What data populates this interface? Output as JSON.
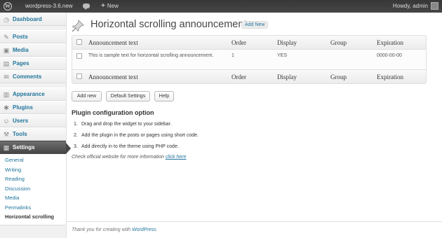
{
  "adminbar": {
    "wp_logo": "W",
    "site_name": "wordpress-3.6.new",
    "new_label": "New",
    "howdy": "Howdy, admin"
  },
  "sidebar": {
    "items": [
      {
        "label": "Dashboard",
        "icon": "dashboard-icon",
        "glyph": "◷"
      },
      {
        "label": "Posts",
        "icon": "pin-icon",
        "glyph": "✎"
      },
      {
        "label": "Media",
        "icon": "media-icon",
        "glyph": "▣"
      },
      {
        "label": "Pages",
        "icon": "pages-icon",
        "glyph": "▤"
      },
      {
        "label": "Comments",
        "icon": "comments-icon",
        "glyph": "✉"
      },
      {
        "label": "Appearance",
        "icon": "appearance-icon",
        "glyph": "▥"
      },
      {
        "label": "Plugins",
        "icon": "plugins-icon",
        "glyph": "✱"
      },
      {
        "label": "Users",
        "icon": "users-icon",
        "glyph": "☺"
      },
      {
        "label": "Tools",
        "icon": "tools-icon",
        "glyph": "⚒"
      },
      {
        "label": "Settings",
        "icon": "settings-icon",
        "glyph": "▦"
      }
    ],
    "submenu": [
      "General",
      "Writing",
      "Reading",
      "Discussion",
      "Media",
      "Permalinks",
      "Horizontal scrolling"
    ]
  },
  "page": {
    "title": "Horizontal scrolling announcement",
    "add_new": "Add New"
  },
  "table": {
    "columns": [
      "Announcement text",
      "Order",
      "Display",
      "Group",
      "Expiration"
    ],
    "rows": [
      [
        "This is sample text for horizontal scrolling announcement.",
        "1",
        "YES",
        "",
        "0000-00-00"
      ]
    ]
  },
  "buttons": {
    "add_new": "Add new",
    "default_settings": "Default Settings",
    "help": "Help"
  },
  "config": {
    "title": "Plugin configuration option",
    "steps": [
      {
        "num": "1.",
        "text": "Drag and drop the widget to your sidebar."
      },
      {
        "num": "2.",
        "text": "Add the plugin in the posts or pages using short code."
      },
      {
        "num": "3.",
        "text": "Add directly in to the theme using PHP code."
      }
    ],
    "check_text": "Check official website for more information",
    "click_here": "click here"
  },
  "footer": {
    "text": "Thank you for creating with",
    "link": "WordPress"
  },
  "colors": {
    "link": "#21759b",
    "adminbar": "#464646",
    "active_menu": "#464646"
  }
}
